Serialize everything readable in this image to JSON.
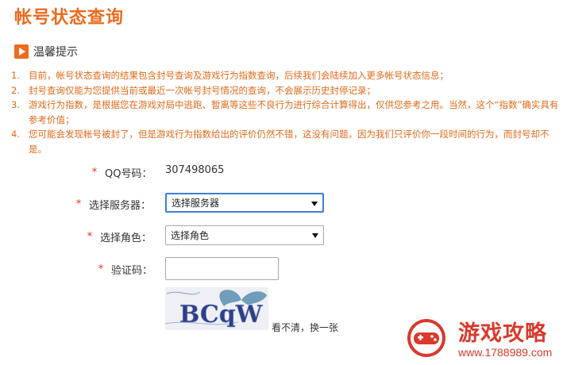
{
  "page": {
    "title": "帐号状态查询"
  },
  "tips": {
    "title": "温馨提示",
    "items": [
      {
        "num": "1.",
        "text": "目前，帐号状态查询的结果包含封号查询及游戏行为指数查询，后续我们会陆续加入更多帐号状态信息；"
      },
      {
        "num": "2.",
        "text": "封号查询仅能为您提供当前或最近一次帐号封号情况的查询，不会展示历史封停记录；"
      },
      {
        "num": "3.",
        "text": "游戏行为指数，是根据您在游戏对局中逃跑、暂离等这些不良行为进行综合计算得出，仅供您参考之用。当然，这个“指数”确实具有参考价值；"
      },
      {
        "num": "4.",
        "text": "您可能会发现帐号被封了，但是游戏行为指数给出的评价仍然不错，这没有问题，因为我们只评价你一段时间的行为，而封号却不是。"
      }
    ]
  },
  "form": {
    "required_mark": "*",
    "qq": {
      "label": "QQ号码：",
      "value": "307498065"
    },
    "server": {
      "label": "选择服务器：",
      "selected": "选择服务器"
    },
    "role": {
      "label": "选择角色：",
      "selected": "选择角色"
    },
    "captcha": {
      "label": "验证码：",
      "value": "",
      "image_text": "BCqW",
      "refresh_text": "看不清，换一张"
    }
  },
  "watermark": {
    "name": "游戏攻略",
    "url": "www.1788989.com"
  },
  "colors": {
    "accent": "#ee6a1d",
    "tip_text": "#e06a1a",
    "required": "#e0301e",
    "focus": "#3c7fd9",
    "watermark": "#d93a2c"
  }
}
